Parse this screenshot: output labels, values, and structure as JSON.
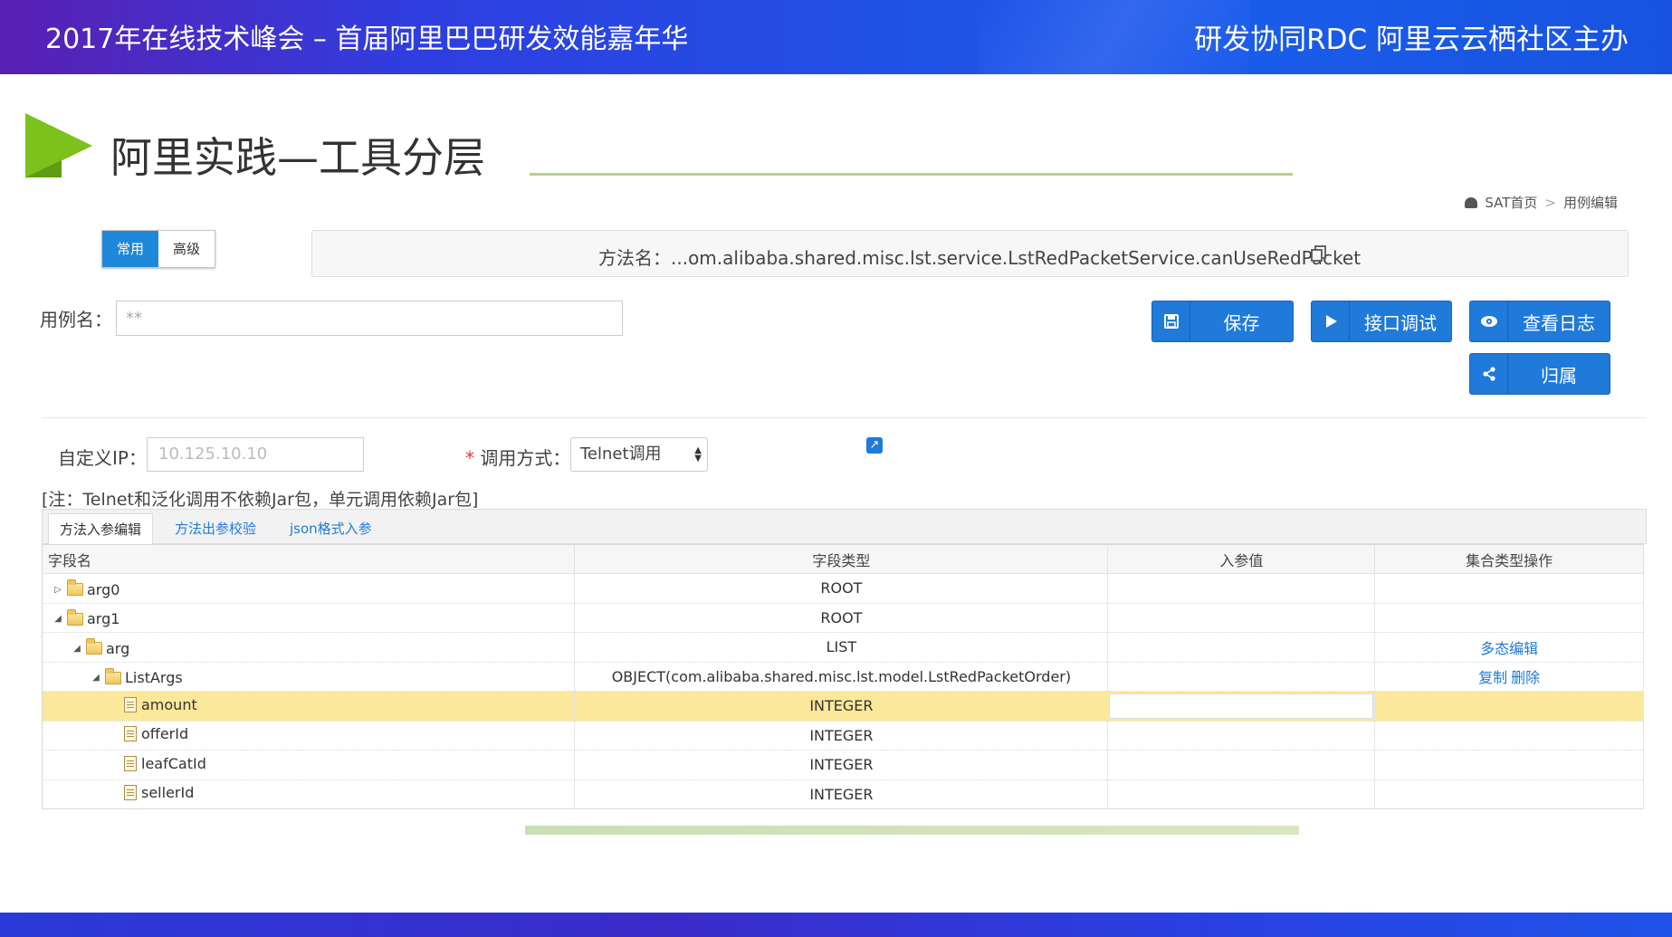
{
  "banner": {
    "left_text": "2017年在线技术峰会 – 首届阿里巴巴研发效能嘉年华",
    "right_text": "研发协同RDC 阿里云云栖社区主办"
  },
  "slide": {
    "title": "阿里实践—工具分层"
  },
  "breadcrumb": {
    "home": "SAT首页",
    "separator": ">",
    "current": "用例编辑"
  },
  "mode_toggle": {
    "common": "常用",
    "advanced": "高级",
    "active": "常用"
  },
  "method": {
    "label": "方法名：",
    "value": "...om.alibaba.shared.misc.lst.service.LstRedPacketService.canUseRedPacket"
  },
  "case_name": {
    "label": "用例名：",
    "value": "**"
  },
  "buttons": {
    "save": "保存",
    "debug": "接口调试",
    "view_log": "查看日志",
    "belong": "归属"
  },
  "ip": {
    "label": "自定义IP：",
    "value": "10.125.10.10"
  },
  "call_mode": {
    "required_mark": "*",
    "label": "调用方式：",
    "value": "Telnet调用"
  },
  "note": "[注：Telnet和泛化调用不依赖Jar包，单元调用依赖Jar包]",
  "tabs": [
    "方法入参编辑",
    "方法出参校验",
    "json格式入参"
  ],
  "table": {
    "headers": [
      "字段名",
      "字段类型",
      "入参值",
      "集合类型操作"
    ],
    "rows": [
      {
        "name": "arg0",
        "type": "ROOT",
        "ops": []
      },
      {
        "name": "arg1",
        "type": "ROOT",
        "ops": []
      },
      {
        "name": "arg",
        "type": "LIST",
        "ops": [
          "多态编辑"
        ]
      },
      {
        "name": "ListArgs",
        "type": "OBJECT(com.alibaba.shared.misc.lst.model.LstRedPacketOrder)",
        "ops": [
          "复制",
          "删除"
        ]
      },
      {
        "name": "amount",
        "type": "INTEGER",
        "ops": []
      },
      {
        "name": "offerId",
        "type": "INTEGER",
        "ops": []
      },
      {
        "name": "leafCatId",
        "type": "INTEGER",
        "ops": []
      },
      {
        "name": "sellerId",
        "type": "INTEGER",
        "ops": []
      }
    ]
  },
  "colors": {
    "accent_blue": "#1f7ad9",
    "green_triangle": "#7cc11c",
    "highlight_row": "#fbe89a"
  },
  "icons": [
    "dashboard-icon",
    "copy-icon",
    "save-icon",
    "play-icon",
    "eye-icon",
    "share-icon",
    "external-link-icon",
    "folder-icon",
    "file-icon"
  ]
}
